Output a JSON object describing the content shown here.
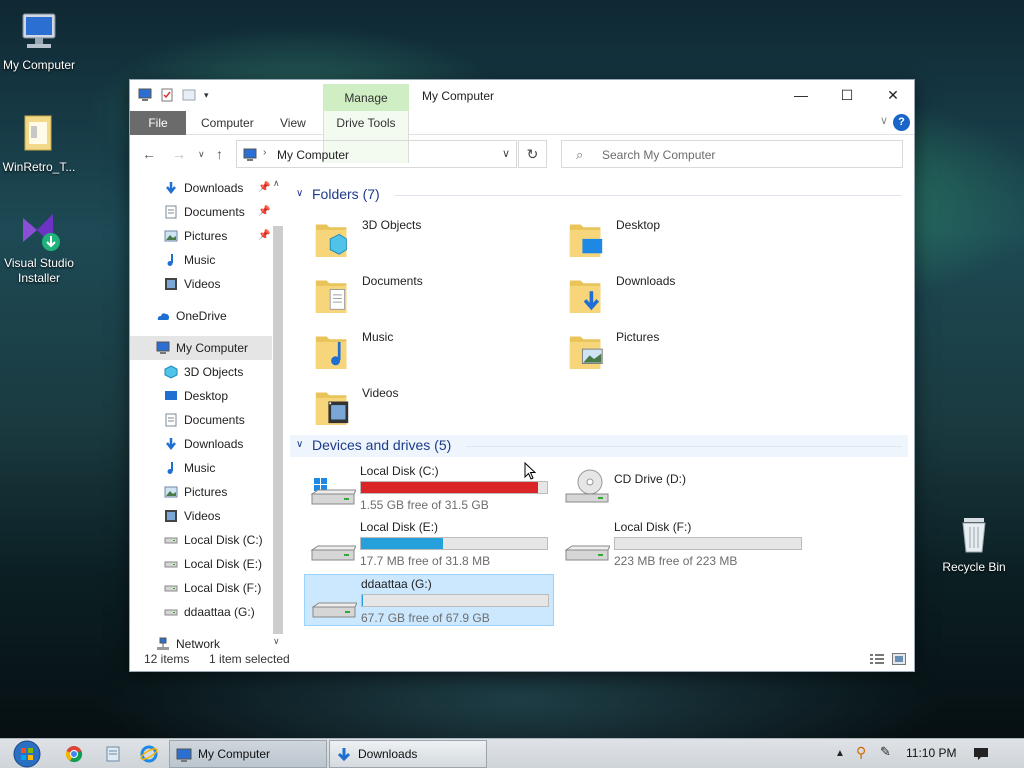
{
  "desktop": {
    "icons": [
      {
        "label": "My Computer"
      },
      {
        "label": "WinRetro_T..."
      },
      {
        "label": "Visual Studio Installer"
      },
      {
        "label": "Recycle Bin"
      }
    ]
  },
  "window": {
    "title": "My Computer",
    "contextual_tab": "Manage",
    "ribbon_tabs": [
      "File",
      "Computer",
      "View",
      "Drive Tools"
    ],
    "address": "My Computer",
    "search_placeholder": "Search My Computer"
  },
  "sidebar": {
    "items": [
      {
        "label": "Downloads",
        "icon": "downloads-icon",
        "pinned": true
      },
      {
        "label": "Documents",
        "icon": "documents-icon",
        "pinned": true
      },
      {
        "label": "Pictures",
        "icon": "pictures-icon",
        "pinned": true
      },
      {
        "label": "Music",
        "icon": "music-icon",
        "pinned": false
      },
      {
        "label": "Videos",
        "icon": "videos-icon",
        "pinned": false
      },
      {
        "label": "OneDrive",
        "icon": "onedrive-icon"
      },
      {
        "label": "My Computer",
        "icon": "computer-icon"
      },
      {
        "label": "3D Objects",
        "icon": "3d-objects-icon"
      },
      {
        "label": "Desktop",
        "icon": "desktop-icon"
      },
      {
        "label": "Documents",
        "icon": "documents-icon"
      },
      {
        "label": "Downloads",
        "icon": "downloads-icon"
      },
      {
        "label": "Music",
        "icon": "music-icon"
      },
      {
        "label": "Pictures",
        "icon": "pictures-icon"
      },
      {
        "label": "Videos",
        "icon": "videos-icon"
      },
      {
        "label": "Local Disk (C:)",
        "icon": "drive-icon"
      },
      {
        "label": "Local Disk (E:)",
        "icon": "drive-icon"
      },
      {
        "label": "Local Disk (F:)",
        "icon": "drive-icon"
      },
      {
        "label": "ddaattaa (G:)",
        "icon": "drive-icon"
      },
      {
        "label": "Network",
        "icon": "network-icon"
      }
    ]
  },
  "folders": {
    "header": "Folders (7)",
    "items": [
      {
        "name": "3D Objects"
      },
      {
        "name": "Desktop"
      },
      {
        "name": "Documents"
      },
      {
        "name": "Downloads"
      },
      {
        "name": "Music"
      },
      {
        "name": "Pictures"
      },
      {
        "name": "Videos"
      }
    ]
  },
  "drives": {
    "header": "Devices and drives (5)",
    "items": [
      {
        "name": "Local Disk (C:)",
        "free": "1.55 GB free of 31.5 GB",
        "used_fraction": 0.95,
        "color": "#da2626"
      },
      {
        "name": "CD Drive (D:)",
        "free": "",
        "used_fraction": null
      },
      {
        "name": "Local Disk (E:)",
        "free": "17.7 MB free of 31.8 MB",
        "used_fraction": 0.44,
        "color": "#26a0da"
      },
      {
        "name": "Local Disk (F:)",
        "free": "223 MB free of 223 MB",
        "used_fraction": 0.0,
        "color": "#26a0da"
      },
      {
        "name": "ddaattaa (G:)",
        "free": "67.7 GB free of 67.9 GB",
        "used_fraction": 0.003,
        "color": "#26a0da"
      }
    ]
  },
  "status": {
    "count": "12 items",
    "selection": "1 item selected"
  },
  "taskbar": {
    "tasks": [
      "My Computer",
      "Downloads"
    ],
    "clock": "11:10 PM"
  }
}
